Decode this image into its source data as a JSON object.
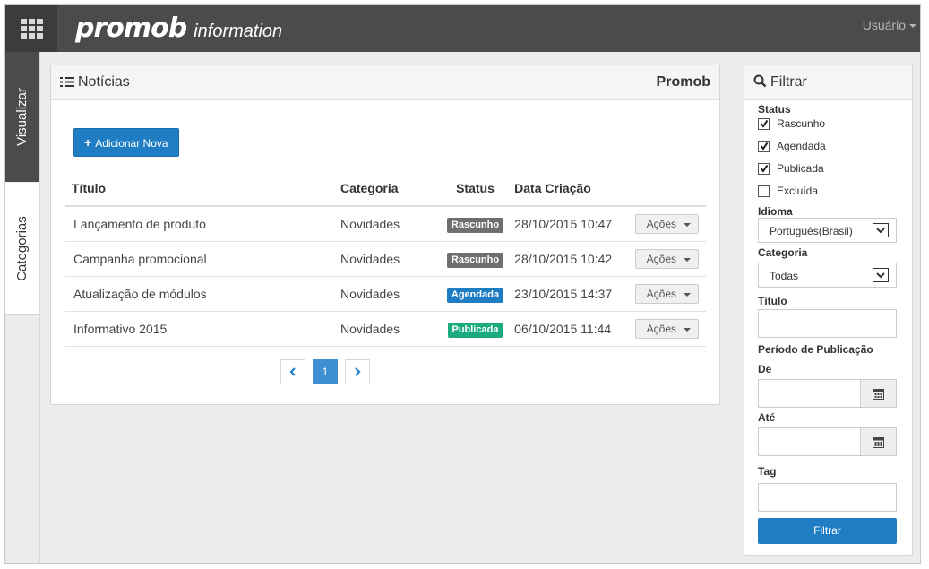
{
  "topbar": {
    "brand_main": "promob",
    "brand_sub": "information",
    "user_label": "Usuário"
  },
  "side_tabs": [
    {
      "label": "Visualizar",
      "active": true
    },
    {
      "label": "Categorias",
      "active": false
    }
  ],
  "main": {
    "title": "Notícias",
    "right_label": "Promob",
    "add_button": "Adicionar Nova",
    "columns": {
      "title": "Título",
      "category": "Categoria",
      "status": "Status",
      "date": "Data Criação"
    },
    "rows": [
      {
        "title": "Lançamento de produto",
        "category": "Novidades",
        "status": "Rascunho",
        "status_color": "#6f6f6f",
        "date": "28/10/2015 10:47",
        "action": "Ações"
      },
      {
        "title": "Campanha promocional",
        "category": "Novidades",
        "status": "Rascunho",
        "status_color": "#6f6f6f",
        "date": "28/10/2015 10:42",
        "action": "Ações"
      },
      {
        "title": "Atualização de módulos",
        "category": "Novidades",
        "status": "Agendada",
        "status_color": "#1f7dc3",
        "date": "23/10/2015 14:37",
        "action": "Ações"
      },
      {
        "title": "Informativo 2015",
        "category": "Novidades",
        "status": "Publicada",
        "status_color": "#1bab7f",
        "date": "06/10/2015 11:44",
        "action": "Ações"
      }
    ],
    "pagination": {
      "current": "1"
    }
  },
  "filter": {
    "title": "Filtrar",
    "status_label": "Status",
    "statuses": [
      {
        "label": "Rascunho",
        "checked": true
      },
      {
        "label": "Agendada",
        "checked": true
      },
      {
        "label": "Publicada",
        "checked": true
      },
      {
        "label": "Excluída",
        "checked": false
      }
    ],
    "language_label": "Idioma",
    "language_value": "Português(Brasil)",
    "category_label": "Categoria",
    "category_value": "Todas",
    "title_label": "Título",
    "period_label": "Período de Publicação",
    "from_label": "De",
    "to_label": "Até",
    "tag_label": "Tag",
    "submit": "Filtrar"
  },
  "colors": {
    "topbar": "#4b4b4b",
    "primary": "#1f7dc3",
    "badge_draft": "#6f6f6f",
    "badge_scheduled": "#1f7dc3",
    "badge_published": "#1bab7f"
  }
}
